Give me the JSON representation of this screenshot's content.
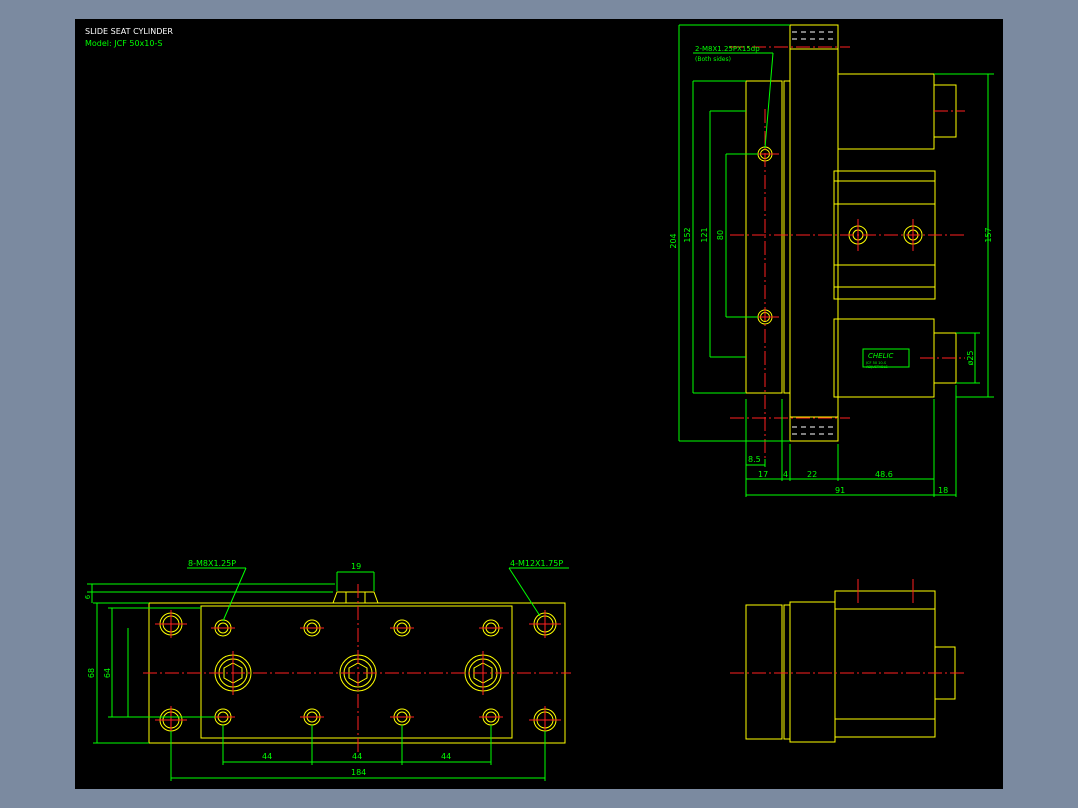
{
  "title": {
    "heading": "SLIDE SEAT CYLINDER",
    "model": "Model: JCF 50x10-S"
  },
  "callouts": {
    "side_tap": "2-M8X1.25PX15dp",
    "side_tap_note": "(Both sides)",
    "bottom_left_tap": "8-M8X1.25P",
    "bottom_right_tap": "4-M12X1.75P"
  },
  "dims_side": {
    "d204": "204",
    "d152": "152",
    "d121": "121",
    "d80": "80",
    "d157": "157",
    "phi25": "ø25",
    "d8_5": "8.5",
    "d17": "17",
    "d4": "4",
    "d22": "22",
    "d48_6": "48.6",
    "d91": "91",
    "d18": "18"
  },
  "dims_bottom": {
    "d19": "19",
    "d6": "6",
    "d68": "68",
    "d64": "64",
    "d44a": "44",
    "d44b": "44",
    "d44c": "44",
    "d184": "184"
  },
  "label_plate": {
    "brand": "CHELIC",
    "line1": "JCF 50 10-S",
    "line2": "ADJUSTABLE"
  },
  "colors": {
    "frame": "#7b8aa0",
    "paper": "#000000",
    "outline": "#ffff00",
    "dimension": "#00ff00",
    "centerline": "#ff2020"
  }
}
